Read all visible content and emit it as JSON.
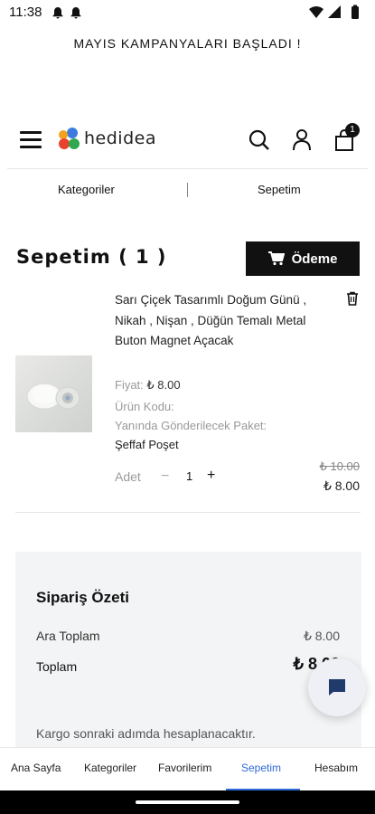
{
  "status": {
    "time": "11:38"
  },
  "promo": "MAYIS KAMPANYALARI BAŞLADI !",
  "header": {
    "logo_text": "hedidea",
    "cart_count": "1"
  },
  "subnav": {
    "left": "Kategoriler",
    "right": "Sepetim"
  },
  "page": {
    "title": "Sepetim ( 1 )",
    "checkout_label": "Ödeme"
  },
  "item": {
    "title": "Sarı Çiçek Tasarımlı Doğum Günü , Nikah , Nişan , Düğün Temalı Metal Buton Magnet Açacak",
    "price_label": "Fiyat:",
    "price_value": "₺ 8.00",
    "code_label": "Ürün Kodu:",
    "package_label": "Yanında Gönderilecek Paket:",
    "package_value": "Şeffaf Poşet",
    "qty_label": "Adet",
    "qty_minus": "−",
    "qty_value": "1",
    "qty_plus": "+",
    "old_price": "₺ 10.00",
    "new_price": "₺ 8.00"
  },
  "summary": {
    "title": "Sipariş Özeti",
    "subtotal_label": "Ara Toplam",
    "subtotal_value": "₺ 8.00",
    "total_label": "Toplam",
    "total_value": "₺ 8.00",
    "note": "Kargo sonraki adımda hesaplanacaktır."
  },
  "bottom_nav": {
    "items": [
      "Ana Sayfa",
      "Kategoriler",
      "Favorilerim",
      "Sepetim",
      "Hesabım"
    ],
    "active_index": 3
  },
  "colors": {
    "accent": "#2f6bd8",
    "chat_icon": "#1f3a6b"
  }
}
